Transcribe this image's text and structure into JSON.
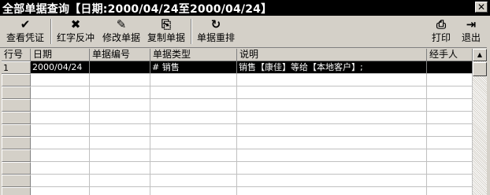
{
  "window": {
    "title": "全部单据查询【日期:2000/04/24至2000/04/24】",
    "close_glyph": "✕"
  },
  "toolbar": {
    "buttons": [
      {
        "label": "查看凭证",
        "icon": "check-icon",
        "glyph": "✔"
      },
      {
        "label": "红字反冲",
        "icon": "x-icon",
        "glyph": "✖"
      },
      {
        "label": "修改单据",
        "icon": "edit-document-icon",
        "glyph": "✎"
      },
      {
        "label": "复制单据",
        "icon": "copy-document-icon",
        "glyph": "⎘"
      },
      {
        "label": "单据重排",
        "icon": "refresh-icon",
        "glyph": "↻"
      },
      {
        "label": "打印",
        "icon": "printer-icon",
        "glyph": "⎙"
      },
      {
        "label": "退出",
        "icon": "exit-door-icon",
        "glyph": "⇥"
      }
    ]
  },
  "table": {
    "columns": [
      "行号",
      "日期",
      "单据编号",
      "单据类型",
      "说明",
      "经手人"
    ],
    "rows": [
      {
        "row_no": "1",
        "date": "2000/04/24",
        "doc_no": "",
        "doc_type": "# 销售",
        "description": "销售【康佳】等给【本地客户】;",
        "handler": ""
      }
    ]
  },
  "scrollbar": {
    "up_glyph": "▲",
    "down_glyph": "▼"
  }
}
